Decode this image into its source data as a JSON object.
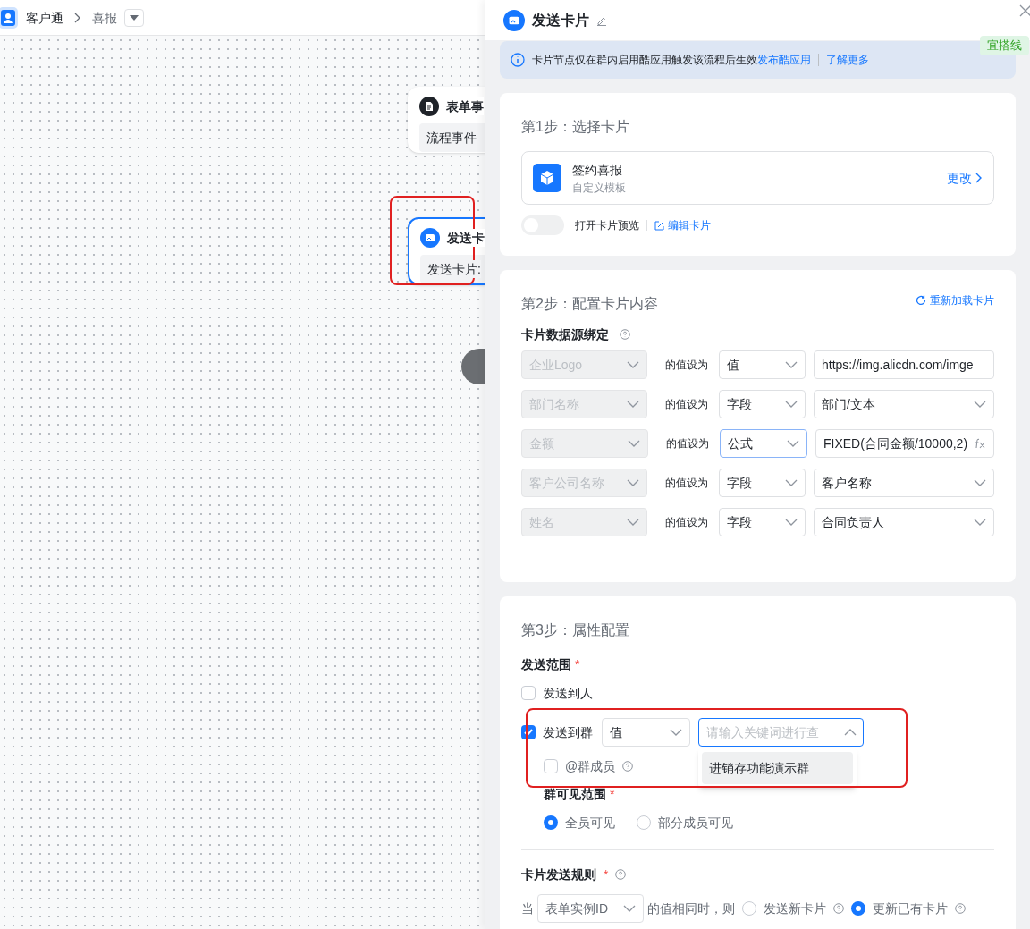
{
  "header": {
    "app_name": "客户通",
    "page": "喜报"
  },
  "canvas": {
    "nodes": [
      {
        "kind": "event",
        "title": "表单事",
        "body": "流程事件",
        "selected": false
      },
      {
        "kind": "card",
        "title": "发送卡",
        "body": "发送卡片: ",
        "selected": true
      }
    ]
  },
  "drawer": {
    "title": "发送卡片",
    "tag": "宜搭线",
    "notice": {
      "text": "卡片节点仅在群内启用酷应用触发该流程后生效",
      "link": "发布酷应用",
      "link2": "了解更多"
    },
    "step1": {
      "title": "第1步：选择卡片",
      "card_name": "签约喜报",
      "card_subtitle": "自定义模板",
      "change": "更改",
      "preview": {
        "label": "打开卡片预览",
        "on": false
      },
      "edit": "编辑卡片"
    },
    "step2": {
      "title": "第2步：配置卡片内容",
      "reload": "重新加载卡片",
      "binding_label": "卡片数据源绑定",
      "rows": [
        {
          "field": "企业Logo",
          "verb": "的值设为",
          "mode": "值",
          "focused": false,
          "kind": "input",
          "value": "https://img.alicdn.com/imge"
        },
        {
          "field": "部门名称",
          "verb": "的值设为",
          "mode": "字段",
          "focused": false,
          "kind": "select",
          "value": "部门/文本"
        },
        {
          "field": "金额",
          "verb": "的值设为",
          "mode": "公式",
          "focused": true,
          "kind": "formula",
          "value": "FIXED(合同金额/10000,2)"
        },
        {
          "field": "客户公司名称",
          "verb": "的值设为",
          "mode": "字段",
          "focused": false,
          "kind": "select",
          "value": "客户名称"
        },
        {
          "field": "姓名",
          "verb": "的值设为",
          "mode": "字段",
          "focused": false,
          "kind": "select",
          "value": "合同负责人"
        }
      ]
    },
    "step3": {
      "title": "第3步：属性配置",
      "scope_label": "发送范围",
      "required_mark": "*",
      "send_person": {
        "label": "发送到人",
        "checked": false
      },
      "send_group": {
        "label": "发送到群",
        "checked": true,
        "mode": "值",
        "search_placeholder": "请输入关键词进行查",
        "dropdown_option": "进销存功能演示群"
      },
      "at_members": {
        "label": "@群成员",
        "checked": false
      },
      "visibility_label": "群可见范围",
      "visibility": [
        {
          "label": "全员可见",
          "selected": true
        },
        {
          "label": "部分成员可见",
          "selected": false
        }
      ],
      "rule_label": "卡片发送规则",
      "rule": {
        "prefix": "当",
        "field": "表单实例ID",
        "middle": "的值相同时，则",
        "options": [
          {
            "label": "发送新卡片",
            "selected": false
          },
          {
            "label": "更新已有卡片",
            "selected": true
          }
        ]
      }
    }
  }
}
